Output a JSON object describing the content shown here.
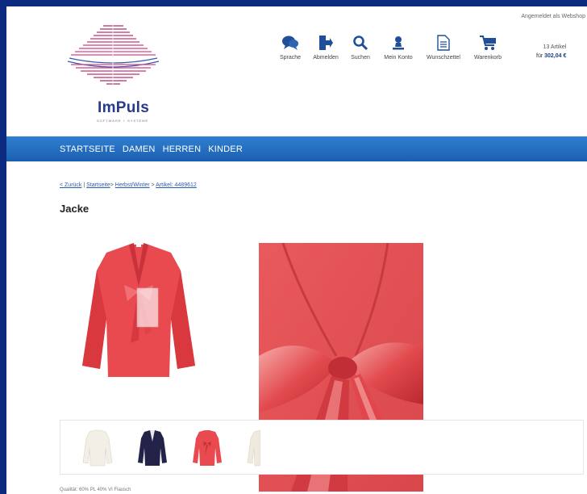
{
  "header": {
    "logo_text": "ImPuls",
    "logo_subtext": "SOFTWARE + SYSTEME",
    "login_status": "Angemeldet als Webshop",
    "tools": [
      {
        "label": "Sprache",
        "icon": "speech-bubble-icon"
      },
      {
        "label": "Abmelden",
        "icon": "logout-icon"
      },
      {
        "label": "Suchen",
        "icon": "search-icon"
      },
      {
        "label": "Mein Konto",
        "icon": "user-icon"
      },
      {
        "label": "Wunschzettel",
        "icon": "document-icon"
      },
      {
        "label": "Warenkorb",
        "icon": "cart-icon"
      }
    ],
    "cart_count": "13 Artikel",
    "cart_total_prefix": "für",
    "cart_total_value": "302,04 €"
  },
  "nav": {
    "items": [
      "STARTSEITE",
      "DAMEN",
      "HERREN",
      "KINDER"
    ]
  },
  "breadcrumb": {
    "back": "< Zurück",
    "sep1": " | ",
    "home": "Startseite",
    "sep2": "> ",
    "category": "Herbst/Winter",
    "sep3": " > ",
    "article": "Artikel: 4489612"
  },
  "product": {
    "title": "Jacke",
    "quality": "Qualität: 60% PL 40% VI Flausch"
  },
  "colors": {
    "accent": "#1f68bb",
    "frame": "#0b2a80",
    "jacket_red": "#e84a50"
  }
}
